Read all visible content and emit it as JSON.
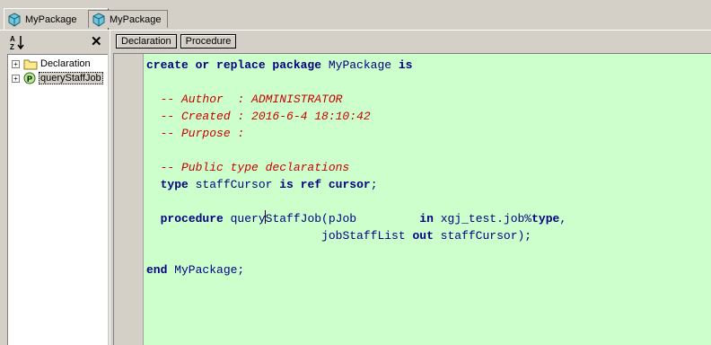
{
  "tabs": [
    {
      "label": "MyPackage",
      "icon": "package-icon",
      "active": true
    },
    {
      "label": "MyPackage",
      "icon": "package-icon",
      "active": false
    }
  ],
  "left_panel": {
    "sort_label": "A\nZ",
    "close_symbol": "✕",
    "tree": [
      {
        "label": "Declaration",
        "icon": "folder-icon",
        "expander": "+"
      },
      {
        "label": "queryStaffJob",
        "icon": "procedure-icon",
        "expander": "+"
      }
    ]
  },
  "editor_tabs": [
    "Declaration",
    "Procedure"
  ],
  "code": {
    "line1_kw": "create or replace package",
    "line1_name": " MyPackage ",
    "line1_is": "is",
    "comment_author": "  -- Author  : ADMINISTRATOR",
    "comment_created": "  -- Created : 2016-6-4 18:10:42",
    "comment_purpose": "  -- Purpose :",
    "comment_public": "  -- Public type declarations",
    "type_kw": "type",
    "type_name": " staffCursor ",
    "is_kw": "is",
    "ref_kw": " ref cursor",
    "semi": ";",
    "proc_kw": "procedure",
    "proc_name_a": " query",
    "proc_name_b": "StaffJob(",
    "param1": "pJob         ",
    "in_kw": "in",
    "param1_type": " xgj_test.job%",
    "type_kw2": "type",
    "comma": ",",
    "indent2": "                         ",
    "param2": "jobStaffList ",
    "out_kw": "out",
    "param2_type": " staffCursor);",
    "end_kw": "end",
    "end_name": " MyPackage;"
  }
}
